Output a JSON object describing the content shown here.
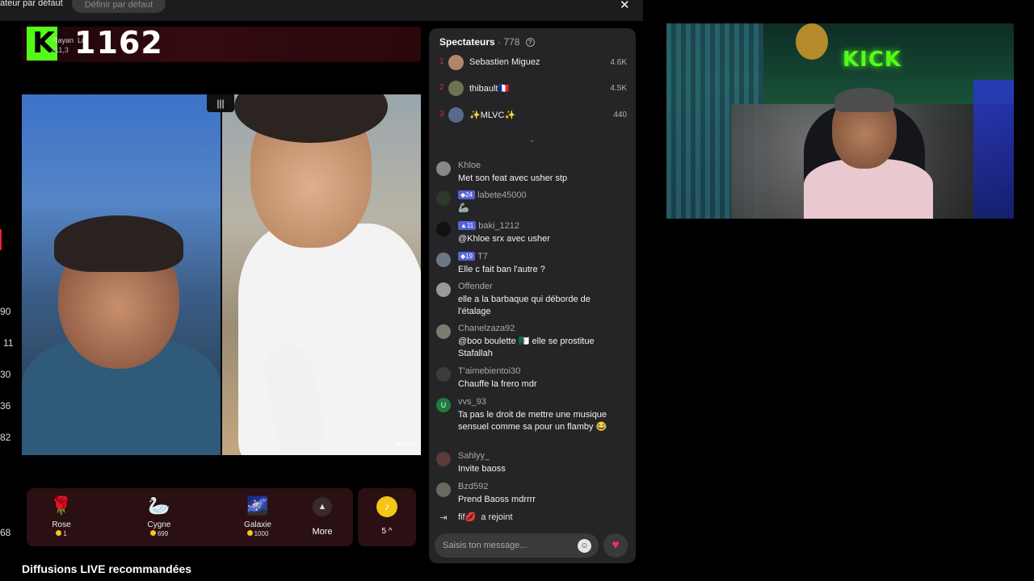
{
  "topbar": {
    "partial_label": "ateur par défaut",
    "set_default_label": "Définir par défaut",
    "close_glyph": "✕"
  },
  "side_numbers": [
    "90",
    "11",
    "30",
    "36",
    "82",
    "68"
  ],
  "live": {
    "viewer_count": "1162",
    "host_partial": "Rayan",
    "host_partial_suffix": "Lu",
    "host_sub_partial": "211,3"
  },
  "video": {
    "watermark": "SUSU"
  },
  "gifts": [
    {
      "name": "Rose",
      "price": "1",
      "icon": "rose-icon",
      "glyph": "🌹"
    },
    {
      "name": "Cygne",
      "price": "699",
      "icon": "swan-icon",
      "glyph": "🦢"
    },
    {
      "name": "Galaxie",
      "price": "1000",
      "icon": "galaxy-icon",
      "glyph": "🌌"
    }
  ],
  "more_label": "More",
  "coins_label": "5",
  "recommended_title": "Diffusions LIVE recommandées",
  "chat": {
    "title": "Spectateurs",
    "count": "· 778",
    "top_viewers": [
      {
        "rank": "1",
        "name": "Sebastien Miguez",
        "score": "4.6K"
      },
      {
        "rank": "2",
        "name": "thibault🇫🇷",
        "score": "4.5K"
      },
      {
        "rank": "3",
        "name": "✨MLVC✨",
        "score": "440"
      }
    ],
    "messages": [
      {
        "user": "Khloe",
        "badge": "",
        "text": "Met son feat avec usher stp"
      },
      {
        "user": "labete45000",
        "badge": "24",
        "text": "🦾"
      },
      {
        "user": "baki_1212",
        "badge": "11",
        "text": "@Khloe srx avec usher"
      },
      {
        "user": "T7",
        "badge": "19",
        "text": "Elle c fait ban l'autre ?"
      },
      {
        "user": "Offender",
        "badge": "",
        "text": "elle a la barbaque qui déborde de l'étalage"
      },
      {
        "user": "Chanelzaza92",
        "badge": "",
        "text": "@boo boulette 🇩🇿 elle se prostitue Stafallah"
      },
      {
        "user": "T'aimebientoi30",
        "badge": "",
        "text": "Chauffe la frero mdr"
      },
      {
        "user": "vvs_93",
        "badge": "",
        "text": "Ta pas le droit de mettre une musique sensuel comme sa pour un flamby 😂"
      },
      {
        "user": "Sahlyy_",
        "badge": "",
        "text": "Invite baoss"
      },
      {
        "user": "Bzd592",
        "badge": "",
        "text": "Prend Baoss mdrrrr"
      }
    ],
    "join_user": "fif💋",
    "join_text": "a rejoint",
    "input_placeholder": "Saisis ton message..."
  },
  "webcam": {
    "sign_text": "KICK"
  },
  "colors": {
    "accent_red": "#e0243a",
    "kick_green": "#53fc18",
    "badge_blue": "#5660d8",
    "chat_bg": "#252527"
  }
}
